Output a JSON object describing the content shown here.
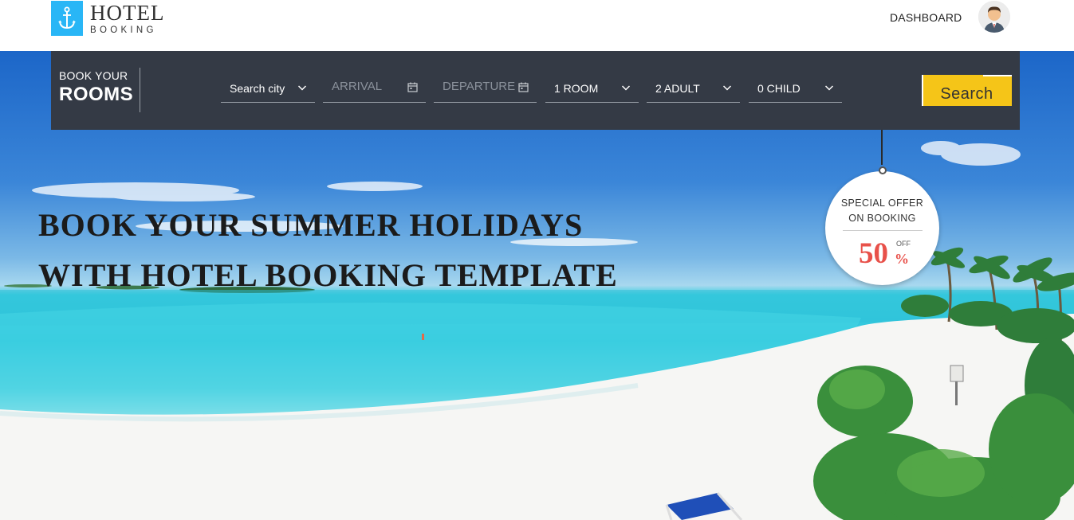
{
  "header": {
    "logo_title": "HOTEL",
    "logo_subtitle": "BOOKING",
    "logo_icon": "anchor-icon",
    "nav_dashboard": "DASHBOARD",
    "avatar_icon": "user-avatar-icon"
  },
  "booking": {
    "label_small": "BOOK YOUR",
    "label_big": "ROOMS",
    "city": "Search city",
    "arrival_placeholder": "ARRIVAL",
    "departure_placeholder": "DEPARTURE",
    "rooms": "1 ROOM",
    "adults": "2 ADULT",
    "children": "0 CHILD",
    "search_label": "Search",
    "icons": [
      "chevron-down-icon",
      "calendar-icon"
    ]
  },
  "hero": {
    "headline_line1": "BOOK YOUR SUMMER HOLIDAYS",
    "headline_line2": "WITH HOTEL BOOKING TEMPLATE"
  },
  "offer": {
    "line1": "SPECIAL OFFER",
    "line2": "ON BOOKING",
    "value": "50",
    "percent": "%",
    "off": "OFF"
  },
  "colors": {
    "accent": "#f5c518",
    "bar_bg": "#343a45",
    "logo_bg": "#29b6f6",
    "offer_red": "#e8514a"
  }
}
